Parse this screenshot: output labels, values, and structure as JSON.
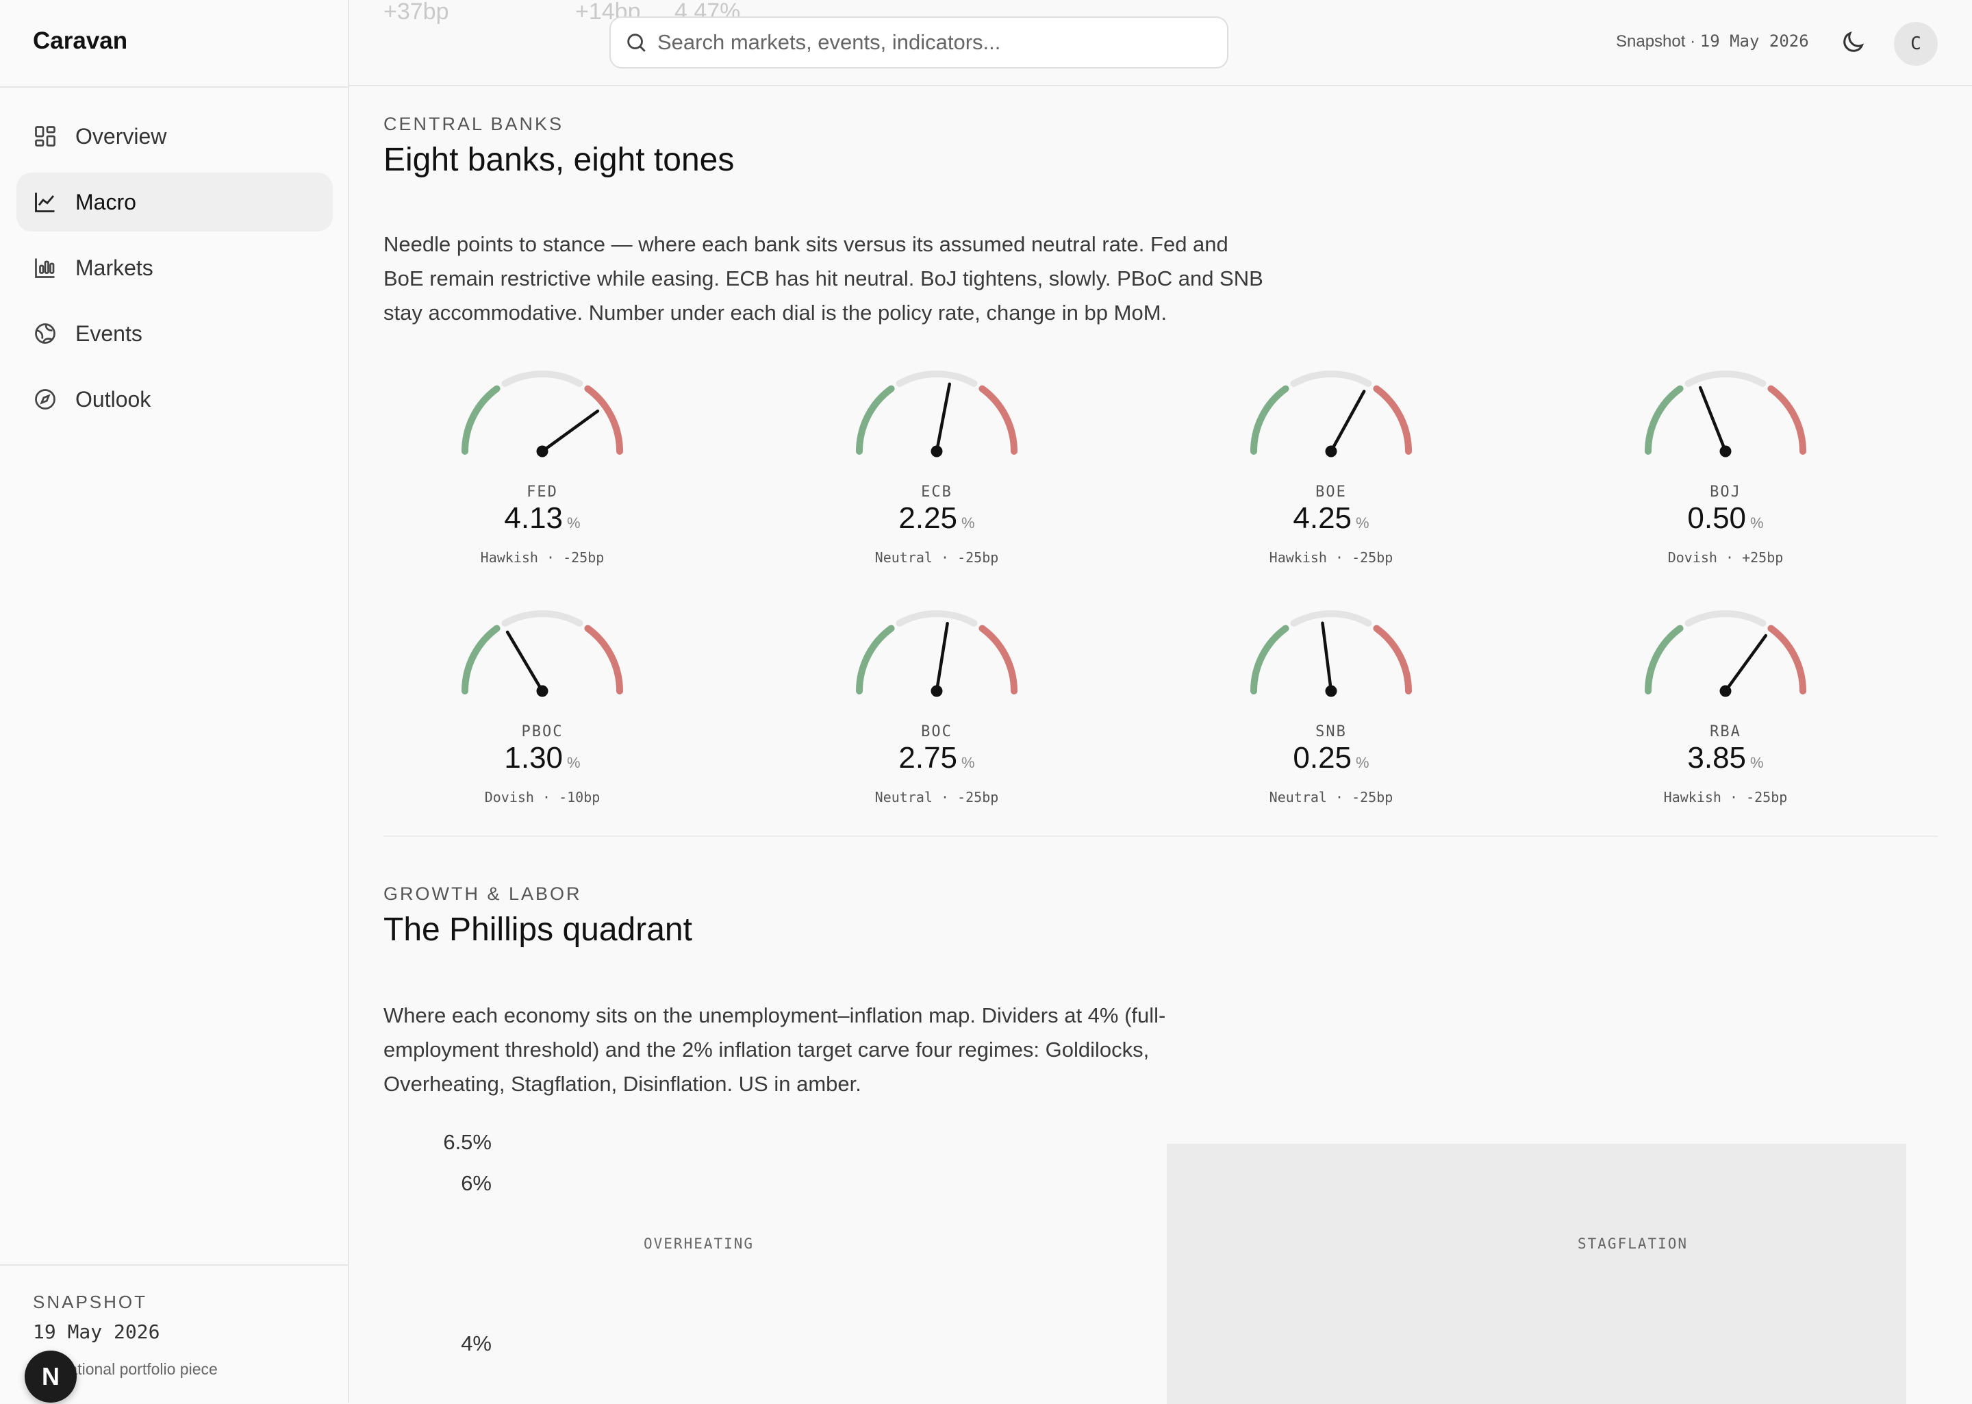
{
  "sidebar": {
    "brand": "Caravan",
    "items": [
      {
        "label": "Overview",
        "icon": "grid-icon",
        "active": false
      },
      {
        "label": "Macro",
        "icon": "line-chart-icon",
        "active": true
      },
      {
        "label": "Markets",
        "icon": "bar-chart-icon",
        "active": false
      },
      {
        "label": "Events",
        "icon": "globe-icon",
        "active": false
      },
      {
        "label": "Outlook",
        "icon": "compass-icon",
        "active": false
      }
    ],
    "footer": {
      "label": "SNAPSHOT",
      "date": "19 May 2026",
      "note": "Educational portfolio piece",
      "badge": "N"
    }
  },
  "topbar": {
    "ghost": [
      "+37bp",
      "+14bp",
      "4.47%"
    ],
    "search_placeholder": "Search markets, events, indicators...",
    "snapshot_prefix": "Snapshot ·",
    "snapshot_date": "19 May 2026",
    "avatar": "C"
  },
  "central_banks": {
    "eyebrow": "CENTRAL BANKS",
    "title": "Eight banks, eight tones",
    "description": "Needle points to stance — where each bank sits versus its assumed neutral rate. Fed and BoE remain restrictive while easing. ECB has hit neutral. BoJ tightens, slowly. PBoC and SNB stay accommodative. Number under each dial is the policy rate, change in bp MoM.",
    "banks": [
      {
        "code": "FED",
        "rate": "4.13",
        "unit": "%",
        "stance": "Hawkish",
        "change": "-25bp",
        "needle": 0.8
      },
      {
        "code": "ECB",
        "rate": "2.25",
        "unit": "%",
        "stance": "Neutral",
        "change": "-25bp",
        "needle": 0.56
      },
      {
        "code": "BOE",
        "rate": "4.25",
        "unit": "%",
        "stance": "Hawkish",
        "change": "-25bp",
        "needle": 0.66
      },
      {
        "code": "BOJ",
        "rate": "0.50",
        "unit": "%",
        "stance": "Dovish",
        "change": "+25bp",
        "needle": 0.38
      },
      {
        "code": "PBOC",
        "rate": "1.30",
        "unit": "%",
        "stance": "Dovish",
        "change": "-10bp",
        "needle": 0.33
      },
      {
        "code": "BOC",
        "rate": "2.75",
        "unit": "%",
        "stance": "Neutral",
        "change": "-25bp",
        "needle": 0.55
      },
      {
        "code": "SNB",
        "rate": "0.25",
        "unit": "%",
        "stance": "Neutral",
        "change": "-25bp",
        "needle": 0.46
      },
      {
        "code": "RBA",
        "rate": "3.85",
        "unit": "%",
        "stance": "Hawkish",
        "change": "-25bp",
        "needle": 0.7
      }
    ],
    "colors": {
      "dovish": "#7eae88",
      "neutral": "#e4e4e4",
      "hawkish": "#d47a76",
      "needle": "#111111"
    }
  },
  "growth_labor": {
    "eyebrow": "GROWTH & LABOR",
    "title": "The Phillips quadrant",
    "description": "Where each economy sits on the unemployment–inflation map. Dividers at 4% (full-employment threshold) and the 2% inflation target carve four regimes: Goldilocks, Overheating, Stagflation, Disinflation. US in amber.",
    "y_ticks": [
      "6.5%",
      "6%",
      "4%"
    ],
    "quadrants": {
      "top_left": "OVERHEATING",
      "top_right": "STAGFLATION"
    }
  }
}
